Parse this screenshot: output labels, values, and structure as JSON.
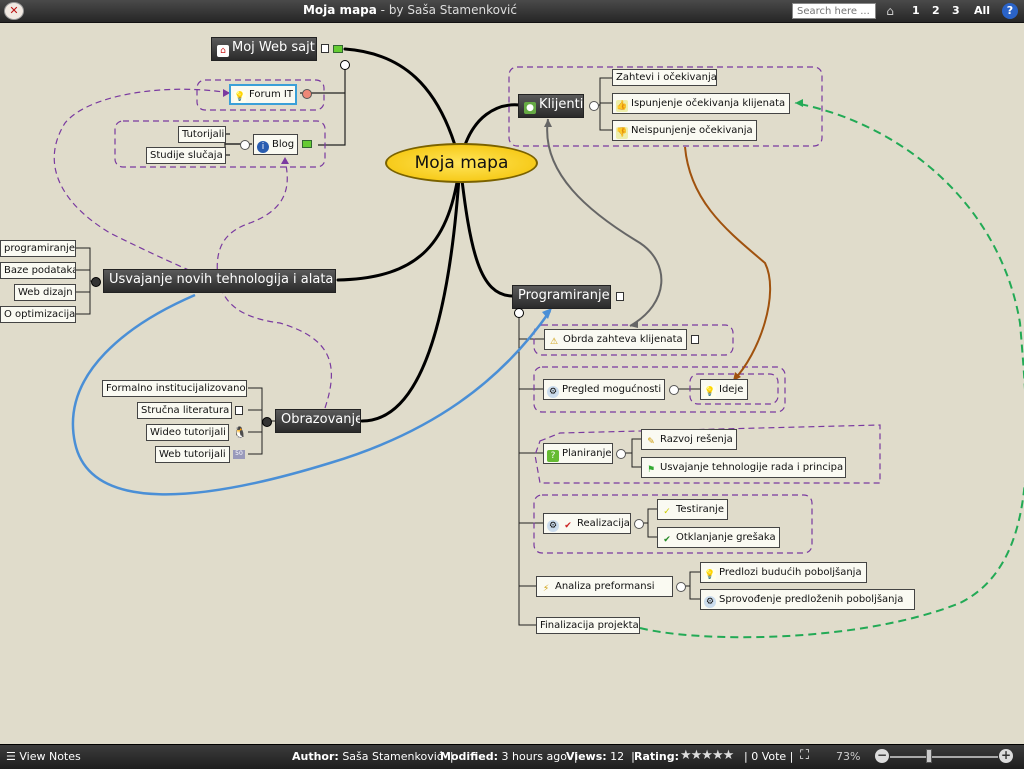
{
  "header": {
    "title": "Moja mapa",
    "byline": " - by Saša Stamenković",
    "search_placeholder": "Search here ...",
    "levels": [
      "1",
      "2",
      "3",
      "All"
    ],
    "help_label": "?"
  },
  "map": {
    "central": "Moja mapa",
    "web_sajt": "Moj Web sajt",
    "forum": "Forum IT",
    "blog": "Blog",
    "tutorijali": "Tutorijali",
    "studije": "Studije slučaja",
    "usvajanje": "Usvajanje novih tehnologija i alata",
    "usvajanje_children": [
      "programiranje",
      "Baze podataka",
      "Web dizajn",
      "O optimizacija"
    ],
    "obrazovanje": "Obrazovanje",
    "obrazovanje_children": [
      "Formalno institucijalizovano",
      "Stručna literatura",
      "Wideo tutorijali",
      "Web tutorijali"
    ],
    "klijenti": "Klijenti",
    "klijenti_children": [
      "Zahtevi i očekivanja",
      "Ispunjenje očekivanja klijenata",
      "Neispunjenje očekivanja"
    ],
    "programiranje": "Programiranje",
    "obrada": "Obrda zahteva klijenata",
    "pregled": "Pregled mogućnosti",
    "ideje": "Ideje",
    "planiranje": "Planiranje",
    "razvoj": "Razvoj rešenja",
    "usvajanje_teh": "Usvajanje tehnologije rada i principa",
    "realizacija": "Realizacija",
    "testiranje": "Testiranje",
    "otklanjanje": "Otklanjanje grešaka",
    "analiza": "Analiza preformansi",
    "predlozi": "Predlozi budućih poboljšanja",
    "sprovodjenje": "Sprovođenje  predloženih poboljšanja",
    "finalizacija": "Finalizacija projekta"
  },
  "footer": {
    "view_notes": "View Notes",
    "author_label": "Author:",
    "author": "Saša Stamenković",
    "modified_label": "Modified:",
    "modified": "3 hours ago",
    "views_label": "Views:",
    "views": "12",
    "rating_label": "Rating:",
    "rating_stars": 0,
    "votes": "0 Vote",
    "zoom": "73%"
  },
  "colors": {
    "background": "#e0dccb",
    "central_fill": "#f8d21c",
    "purple_dash": "#7a3aa0",
    "green_dash": "#22aa55",
    "blue_link": "#4a8fd6",
    "brown_link": "#a0520e"
  }
}
